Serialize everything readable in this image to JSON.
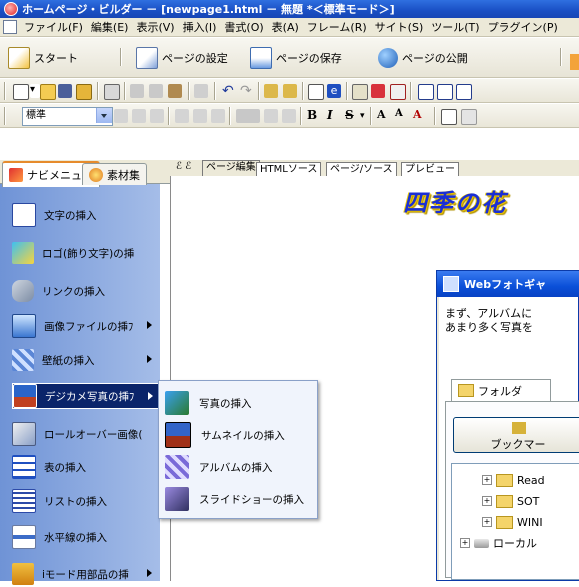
{
  "window": {
    "title": "ホームページ・ビルダー － [newpage1.html － 無題 *＜標準モード＞]"
  },
  "menu": [
    "ファイル(F)",
    "編集(E)",
    "表示(V)",
    "挿入(I)",
    "書式(O)",
    "表(A)",
    "フレーム(R)",
    "サイト(S)",
    "ツール(T)",
    "プラグイン(P)"
  ],
  "bigtoolbar": {
    "start": "スタート",
    "page_settings": "ページの設定",
    "page_save": "ページの保存",
    "page_publish": "ページの公開"
  },
  "format_bar": {
    "style_value": "標準",
    "bold": "B",
    "italic": "I",
    "strike": "S"
  },
  "nav_tabs": {
    "navimenu": "ナビメニュー",
    "materials": "素材集"
  },
  "nav_items": [
    "文字の挿入",
    "ロゴ(飾り文字)の挿",
    "リンクの挿入",
    "画像ファイルの挿ﾌ",
    "壁紙の挿入",
    "デジカメ写真の挿ﾌ",
    "ロールオーバー画像(",
    "表の挿入",
    "リストの挿入",
    "水平線の挿入",
    "iモード用部品の挿"
  ],
  "submenu": [
    "写真の挿入",
    "サムネイルの挿入",
    "アルバムの挿入",
    "スライドショーの挿入"
  ],
  "editor_tabs": [
    "ページ編集",
    "HTMLソース",
    "ページ/ソース",
    "プレビュー"
  ],
  "page_heading": "四季の花",
  "dialog": {
    "title": "Webフォトギャ",
    "message_line1": "まず、アルバムに",
    "message_line2": "あまり多く写真を",
    "folder_tab": "フォルダ",
    "bookmark_button": "ブックマー",
    "tree": [
      "Read",
      "SOT",
      "WINI",
      "ローカル"
    ]
  },
  "colors": {
    "titlebar": "#1a4fc4",
    "nav_panel": "#8aaae0",
    "selected": "#0a246a",
    "heading": "#1b2fd4"
  }
}
